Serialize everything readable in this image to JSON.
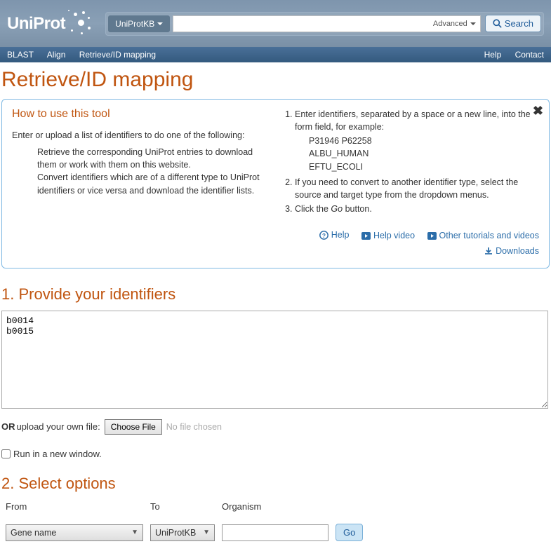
{
  "header": {
    "logo_text": "UniProt",
    "db_selector": "UniProtKB",
    "search_value": "",
    "advanced_label": "Advanced",
    "search_button": "Search"
  },
  "navbar": {
    "left": [
      "BLAST",
      "Align",
      "Retrieve/ID mapping"
    ],
    "right": [
      "Help",
      "Contact"
    ]
  },
  "page_title": "Retrieve/ID mapping",
  "help_box": {
    "title": "How to use this tool",
    "intro": "Enter or upload a list of identifiers to do one of the following:",
    "bullets": [
      "Retrieve the corresponding UniProt entries to download them or work with them on this website.",
      "Convert identifiers which are of a different type to UniProt identifiers or vice versa and download the identifier lists."
    ],
    "step1": "Enter identifiers, separated by a space or a new line, into the form field, for example:",
    "examples": [
      "P31946 P62258",
      "ALBU_HUMAN",
      "EFTU_ECOLI"
    ],
    "step2": "If you need to convert to another identifier type, select the source and target type from the dropdown menus.",
    "step3_a": "Click the ",
    "step3_b": "Go",
    "step3_c": " button.",
    "links": {
      "help": "Help",
      "help_video": "Help video",
      "tutorials": "Other tutorials and videos",
      "downloads": "Downloads"
    }
  },
  "section1_title": "1. Provide your identifiers",
  "identifier_value": "b0014\nb0015",
  "upload": {
    "or": "OR",
    "label": " upload your own file:",
    "choose": "Choose File",
    "no_file": "No file chosen"
  },
  "new_window_label": "Run in a new window.",
  "section2_title": "2. Select options",
  "options": {
    "from_label": "From",
    "to_label": "To",
    "organism_label": "Organism",
    "from_value": "Gene name",
    "to_value": "UniProtKB",
    "organism_value": "",
    "go_button": "Go"
  }
}
